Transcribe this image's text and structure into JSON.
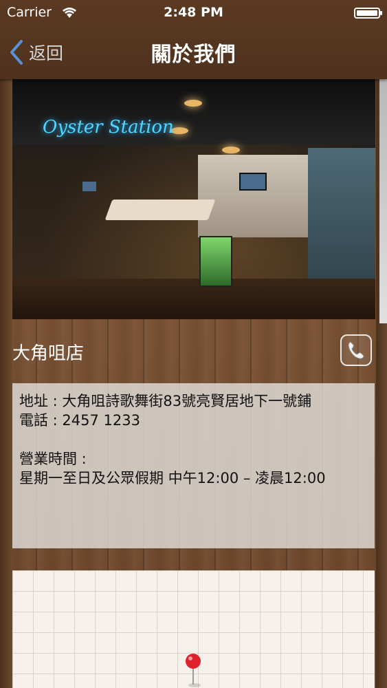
{
  "status_bar": {
    "carrier": "Carrier",
    "time": "2:48 PM"
  },
  "nav": {
    "back_label": "返回",
    "title": "關於我們"
  },
  "photo": {
    "sign_text": "Oyster Station"
  },
  "store": {
    "name": "大角咀店"
  },
  "info": {
    "address_line": "地址 : 大角咀詩歌舞街83號亮賢居地下一號鋪",
    "phone_line": "電話 : 2457 1233",
    "hours_label": "營業時間 :",
    "hours_value": "星期一至日及公眾假期 中午12:00 – 凌晨12:00"
  },
  "colors": {
    "nav_bg": "#5b3a22",
    "map_pin": "#e0202a",
    "sign_neon": "#4fd6ff"
  }
}
